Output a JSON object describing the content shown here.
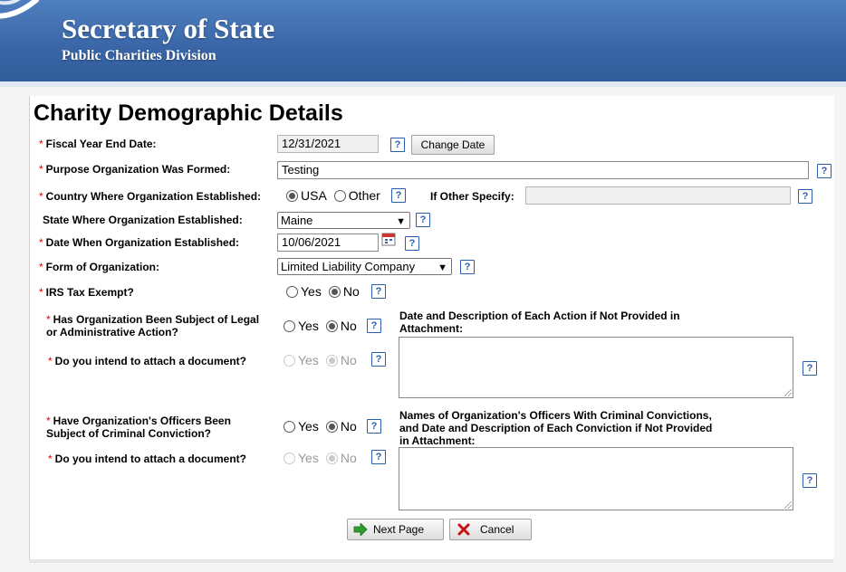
{
  "header": {
    "title": "Secretary of State",
    "subtitle": "Public Charities Division"
  },
  "form": {
    "title": "Charity Demographic Details",
    "required_marker": "*",
    "fiscal_year_end": {
      "label": "Fiscal Year End Date:",
      "value": "12/31/2021",
      "change_button": "Change Date"
    },
    "purpose": {
      "label": "Purpose Organization Was Formed:",
      "value": "Testing"
    },
    "country": {
      "label": "Country Where Organization Established:",
      "options": [
        "USA",
        "Other"
      ],
      "selected": "USA",
      "other_label": "If Other Specify:",
      "other_value": ""
    },
    "state": {
      "label": "State Where Organization Established:",
      "value": "Maine"
    },
    "date_established": {
      "label": "Date When Organization Established:",
      "value": "10/06/2021"
    },
    "form_of_org": {
      "label": "Form of Organization:",
      "value": "Limited Liability Company"
    },
    "irs_exempt": {
      "label": "IRS Tax Exempt?",
      "options": [
        "Yes",
        "No"
      ],
      "selected": "No"
    },
    "legal_action": {
      "label_line1": "Has Organization Been Subject of Legal",
      "label_line2": "or Administrative Action?",
      "options": [
        "Yes",
        "No"
      ],
      "selected": "No",
      "desc_label_line1": "Date and Description of Each Action if Not Provided in",
      "desc_label_line2": "Attachment:"
    },
    "attach_doc_1": {
      "label": "Do you intend to attach a document?",
      "options": [
        "Yes",
        "No"
      ],
      "selected": "No"
    },
    "criminal": {
      "label_line1": "Have Organization's Officers Been",
      "label_line2": "Subject of Criminal Conviction?",
      "options": [
        "Yes",
        "No"
      ],
      "selected": "No",
      "desc_label_line1": "Names of Organization's Officers With Criminal Convictions,",
      "desc_label_line2": "and Date and Description of Each Conviction if Not Provided",
      "desc_label_line3": "in Attachment:"
    },
    "attach_doc_2": {
      "label": "Do you intend to attach a document?",
      "options": [
        "Yes",
        "No"
      ],
      "selected": "No"
    },
    "help_glyph": "?",
    "buttons": {
      "next": "Next Page",
      "cancel": "Cancel"
    }
  },
  "colors": {
    "banner": "#3a66a8",
    "required": "#dd0000",
    "help": "#2a5db0",
    "next_arrow": "#2e9e2e",
    "cancel_x": "#cc1111"
  },
  "icons": [
    "help-icon",
    "calendar-icon",
    "next-arrow-icon",
    "cancel-x-icon",
    "palmetto-logo-icon"
  ]
}
